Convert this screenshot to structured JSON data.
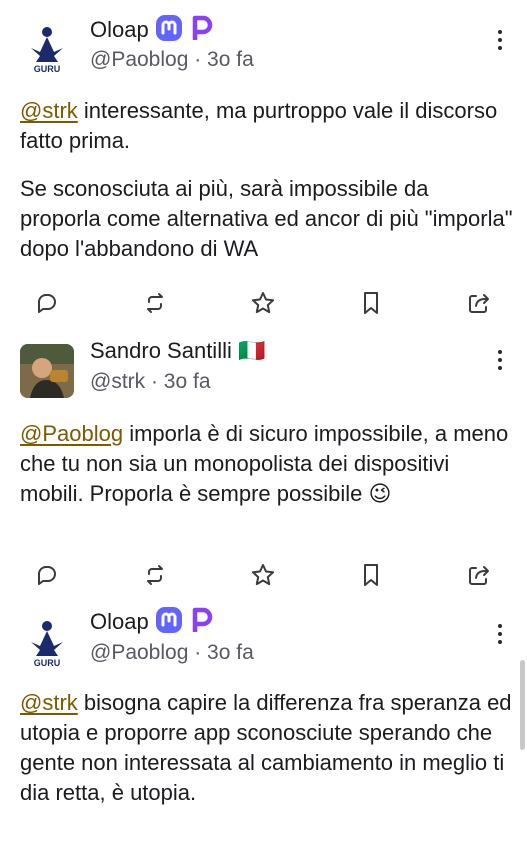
{
  "posts": [
    {
      "display_name": "Oloap",
      "handle": "@Paoblog · 3o fa",
      "avatar_label": "GURU",
      "badges": [
        "mastodon-badge",
        "pixelfed-badge"
      ],
      "paragraphs": [
        {
          "mention": "@strk",
          "text": " interessante, ma purtroppo vale il discorso fatto prima."
        },
        {
          "mention": "",
          "text": "Se sconosciuta ai più, sarà impossibile da proporla come alternativa ed ancor di più \"imporla\" dopo l'abbandono di WA"
        }
      ]
    },
    {
      "display_name": "Sandro Santilli",
      "flag": "🇮🇹",
      "handle": "@strk · 3o fa",
      "paragraphs": [
        {
          "mention": "@Paoblog",
          "text": " imporla è di sicuro impossibile, a meno che tu non sia un monopolista dei dispositivi mobili. Proporla è sempre possibile 😉"
        }
      ]
    },
    {
      "display_name": "Oloap",
      "handle": "@Paoblog · 3o fa",
      "avatar_label": "GURU",
      "badges": [
        "mastodon-badge",
        "pixelfed-badge"
      ],
      "paragraphs": [
        {
          "mention": "@strk",
          "text": " bisogna capire la differenza fra speranza ed utopia e proporre app sconosciute sperando che gente non interessata al cambiamento in meglio ti dia retta, è utopia."
        }
      ]
    }
  ],
  "actions": [
    "reply-icon",
    "boost-icon",
    "favourite-icon",
    "bookmark-icon",
    "share-icon"
  ],
  "colors": {
    "mention": "#7a5b00",
    "mastodon": "#6364ff",
    "pixelfed": "#8a3ffc",
    "text": "#1c1b1f",
    "muted": "#5b5862"
  }
}
